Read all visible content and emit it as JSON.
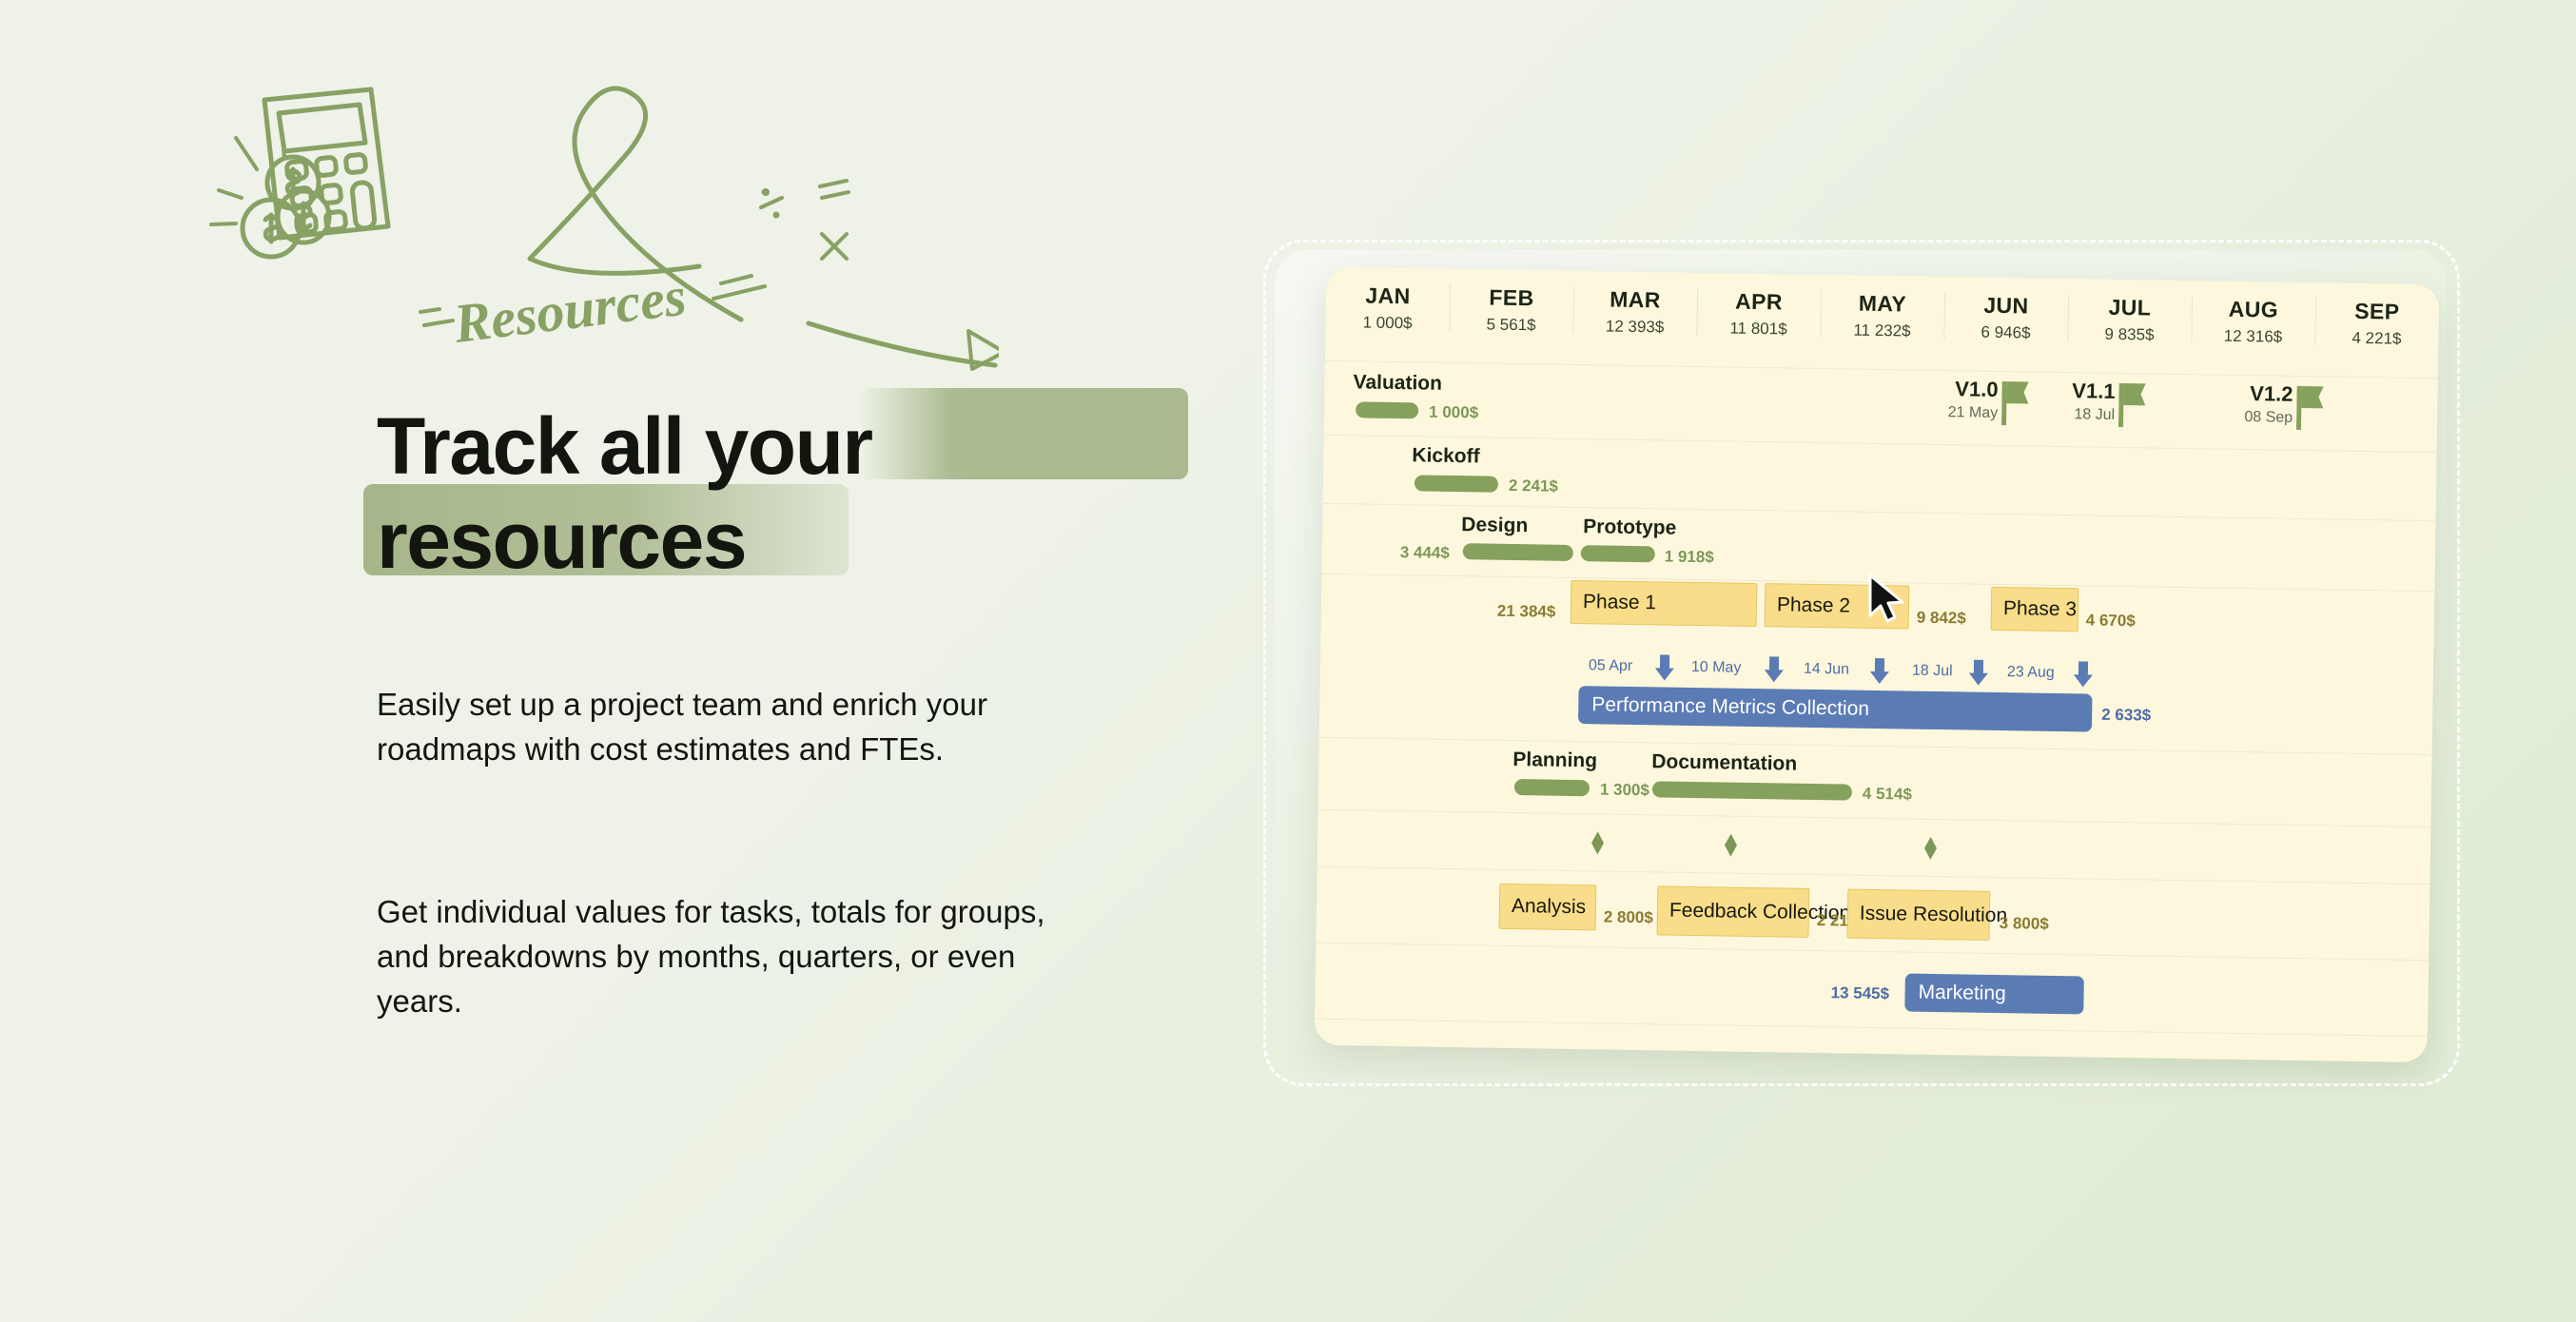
{
  "hero": {
    "doodle_label": "Resources",
    "headline_line1_plain": "Track all ",
    "headline_line1_hl": "your",
    "headline_line2_hl": "resources",
    "paragraph_1": "Easily set up a project team and enrich your roadmaps with cost estimates and FTEs.",
    "paragraph_2": "Get individual values for tasks, totals for groups, and breakdowns by months, quarters, or even years."
  },
  "colors": {
    "green_bar": "#86a05e",
    "green_text": "#7d9757",
    "yellow_box": "#f9dd8a",
    "yellow_border": "#e6c664",
    "blue_bar": "#5b7bb4",
    "card_bg": "#fdf8dd",
    "page_bg": "#eef2e8"
  },
  "gantt": {
    "months": [
      {
        "name": "JAN",
        "cost": "1 000$"
      },
      {
        "name": "FEB",
        "cost": "5 561$"
      },
      {
        "name": "MAR",
        "cost": "12 393$"
      },
      {
        "name": "APR",
        "cost": "11 801$"
      },
      {
        "name": "MAY",
        "cost": "11 232$"
      },
      {
        "name": "JUN",
        "cost": "6 946$"
      },
      {
        "name": "JUL",
        "cost": "9 835$"
      },
      {
        "name": "AUG",
        "cost": "12 316$"
      },
      {
        "name": "SEP",
        "cost": "4 221$"
      }
    ],
    "row_valuation": {
      "label": "Valuation",
      "cost": "1 000$"
    },
    "milestones": [
      {
        "version": "V1.0",
        "date": "21 May"
      },
      {
        "version": "V1.1",
        "date": "18 Jul"
      },
      {
        "version": "V1.2",
        "date": "08 Sep"
      }
    ],
    "row_kickoff": {
      "label": "Kickoff",
      "cost": "2 241$"
    },
    "row_design": {
      "label": "Design",
      "cost": "3 444$"
    },
    "row_prototype": {
      "label": "Prototype",
      "cost": "1 918$"
    },
    "phases": [
      {
        "label": "Phase 1",
        "cost": "21 384$"
      },
      {
        "label": "Phase 2",
        "cost": "9 842$"
      },
      {
        "label": "Phase 3",
        "cost": "4 670$"
      }
    ],
    "date_markers": [
      "05 Apr",
      "10 May",
      "14 Jun",
      "18 Jul",
      "23 Aug"
    ],
    "row_metrics": {
      "label": "Performance Metrics Collection",
      "cost": "2 633$"
    },
    "row_planning": {
      "label": "Planning",
      "cost": "1 300$"
    },
    "row_documentation": {
      "label": "Documentation",
      "cost": "4 514$"
    },
    "tasks": [
      {
        "label": "Analysis",
        "cost": "2 800$"
      },
      {
        "label": "Feedback Collection",
        "cost": "2 214$"
      },
      {
        "label": "Issue Resolution",
        "cost": "3 800$"
      }
    ],
    "row_marketing": {
      "label": "Marketing",
      "cost": "13 545$"
    }
  }
}
